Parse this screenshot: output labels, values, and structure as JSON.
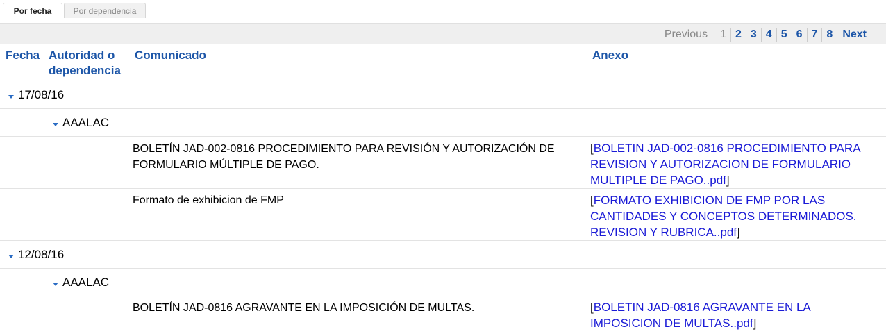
{
  "tabs": [
    {
      "label": "Por fecha"
    },
    {
      "label": "Por dependencia"
    }
  ],
  "pager": {
    "previous": "Previous",
    "pages": [
      "1",
      "2",
      "3",
      "4",
      "5",
      "6",
      "7",
      "8"
    ],
    "current": "1",
    "next": "Next"
  },
  "columns": {
    "fecha": "Fecha",
    "autoridad": "Autoridad o dependencia",
    "comunicado": "Comunicado",
    "anexo": "Anexo"
  },
  "groups": [
    {
      "date": "17/08/16",
      "authority": "AAALAC",
      "items": [
        {
          "comunicado": "BOLETÍN JAD-002-0816 PROCEDIMIENTO PARA REVISIÓN Y AUTORIZACIÓN DE FORMULARIO MÚLTIPLE DE PAGO.",
          "anexo_link": "BOLETIN JAD-002-0816 PROCEDIMIENTO PARA REVISION Y AUTORIZACION DE FORMULARIO MULTIPLE DE PAGO..pdf"
        },
        {
          "comunicado": "Formato de exhibicion de FMP",
          "anexo_link": "FORMATO EXHIBICION DE FMP POR LAS CANTIDADES Y CONCEPTOS DETERMINADOS. REVISION Y RUBRICA..pdf"
        }
      ]
    },
    {
      "date": "12/08/16",
      "authority": "AAALAC",
      "items": [
        {
          "comunicado": "BOLETÍN JAD-0816 AGRAVANTE EN LA IMPOSICIÓN DE MULTAS.",
          "anexo_link": "BOLETIN JAD-0816 AGRAVANTE EN LA IMPOSICION DE MULTAS..pdf"
        }
      ]
    }
  ],
  "colors": {
    "header_blue": "#1d56a8",
    "link_blue": "#1a1ad6",
    "pager_bg": "#efefef"
  }
}
